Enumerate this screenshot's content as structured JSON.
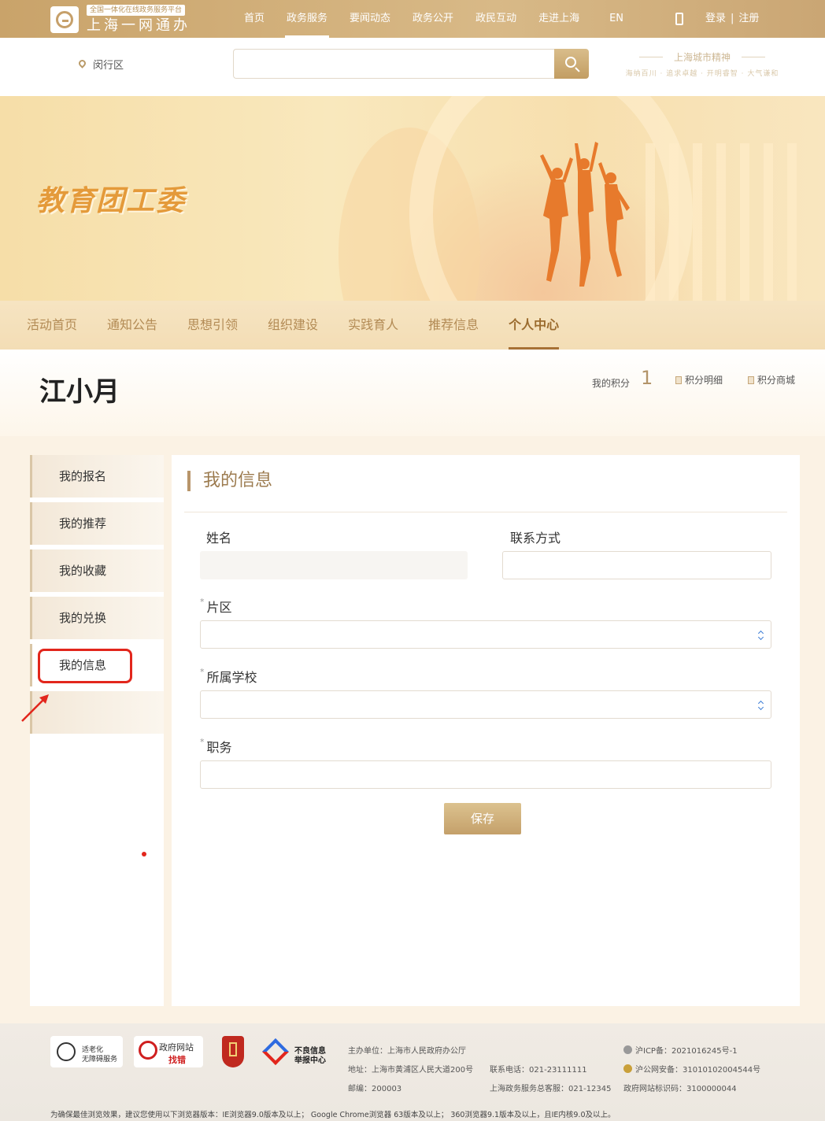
{
  "header": {
    "logo_subtitle": "全国一体化在线政务服务平台",
    "logo_title": "上海一网通办",
    "nav": [
      "首页",
      "政务服务",
      "要闻动态",
      "政务公开",
      "政民互动",
      "走进上海",
      "EN"
    ],
    "active_nav": "政务服务",
    "login": "登录",
    "separator": "|",
    "register": "注册"
  },
  "search": {
    "district": "闵行区",
    "placeholder": "",
    "spirit_title": "上海城市精神",
    "spirit_sub": "海纳百川 · 追求卓越 · 开明睿智 · 大气谦和"
  },
  "banner": {
    "title": "教育团工委"
  },
  "tabs": [
    {
      "label": "活动首页"
    },
    {
      "label": "通知公告"
    },
    {
      "label": "思想引领"
    },
    {
      "label": "组织建设"
    },
    {
      "label": "实践育人"
    },
    {
      "label": "推荐信息"
    },
    {
      "label": "个人中心"
    }
  ],
  "user": {
    "name": "江小月",
    "points_label": "我的积分",
    "points": "1",
    "points_detail": "积分明细",
    "points_mall": "积分商城"
  },
  "sidebar": {
    "items": [
      {
        "label": "我的报名"
      },
      {
        "label": "我的推荐"
      },
      {
        "label": "我的收藏"
      },
      {
        "label": "我的兑换"
      },
      {
        "label": "我的信息"
      }
    ]
  },
  "form": {
    "title": "我的信息",
    "name_label": "姓名",
    "name_value": "",
    "contact_label": "联系方式",
    "contact_value": "",
    "required_mark": "*",
    "district_label": "片区",
    "school_label": "所属学校",
    "position_label": "职务",
    "position_value": "",
    "save_label": "保存"
  },
  "footer": {
    "badge1_line1": "适老化",
    "badge1_line2": "无障碍服务",
    "badge2_line1": "政府网站",
    "badge2_line2": "找错",
    "badge4_line1": "不良信息",
    "badge4_line2": "举报中心",
    "sponsor": "主办单位：上海市人民政府办公厅",
    "address": "地址：上海市黄浦区人民大道200号",
    "postcode": "邮编：200003",
    "phone": "联系电话：021-23111111",
    "hotline": "上海政务服务总客服：021-12345",
    "icp": "沪ICP备：2021016245号-1",
    "police": "沪公网安备：31010102004544号",
    "site_id": "政府网站标识码：3100000044",
    "browser_note": "为确保最佳浏览效果，建议您使用以下浏览器版本：IE浏览器9.0版本及以上； Google Chrome浏览器 63版本及以上； 360浏览器9.1版本及以上，且IE内核9.0及以上。"
  }
}
